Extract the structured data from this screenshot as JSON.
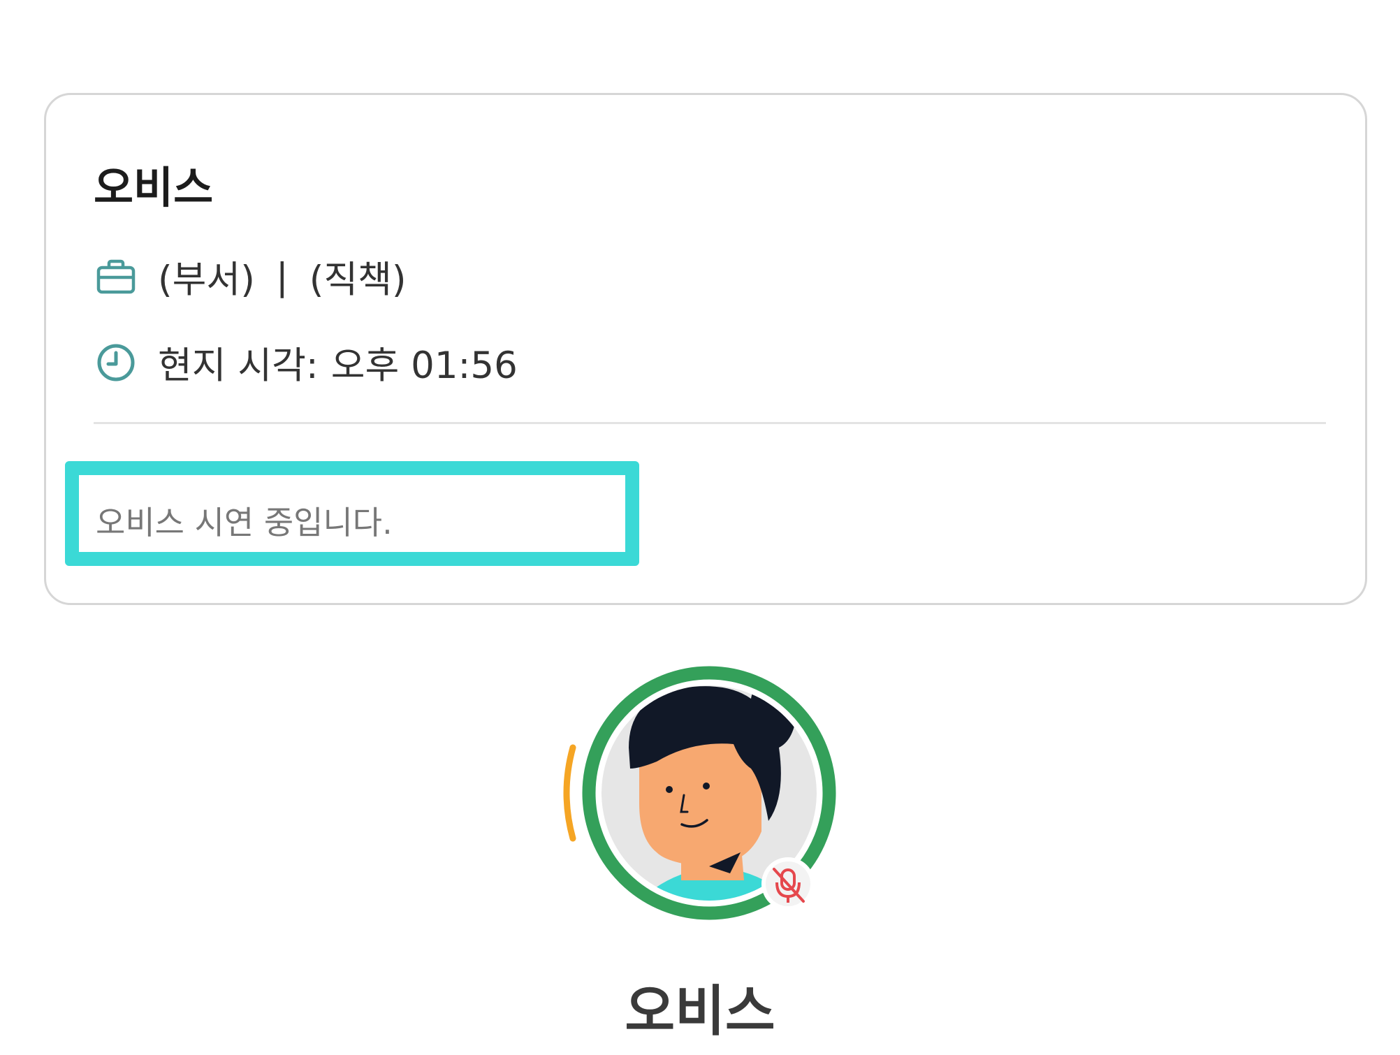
{
  "profile_card": {
    "name": "오비스",
    "department": "(부서)",
    "separator": "|",
    "position": "(직책)",
    "local_time_label": "현지 시각:",
    "local_time_value": "오후 01:56",
    "status_message": "오비스 시연 중입니다.",
    "icons": {
      "department": "briefcase-icon",
      "time": "clock-icon"
    }
  },
  "avatar": {
    "name": "오비스",
    "online_ring_color": "#34a05a",
    "speaking_indicator_color": "#f5a524",
    "mic_status": "muted",
    "mic_icon": "mic-off-icon",
    "mic_icon_color": "#e5484d"
  },
  "colors": {
    "accent_teal": "#4a9a9a",
    "status_highlight": "#3bd9d6"
  }
}
